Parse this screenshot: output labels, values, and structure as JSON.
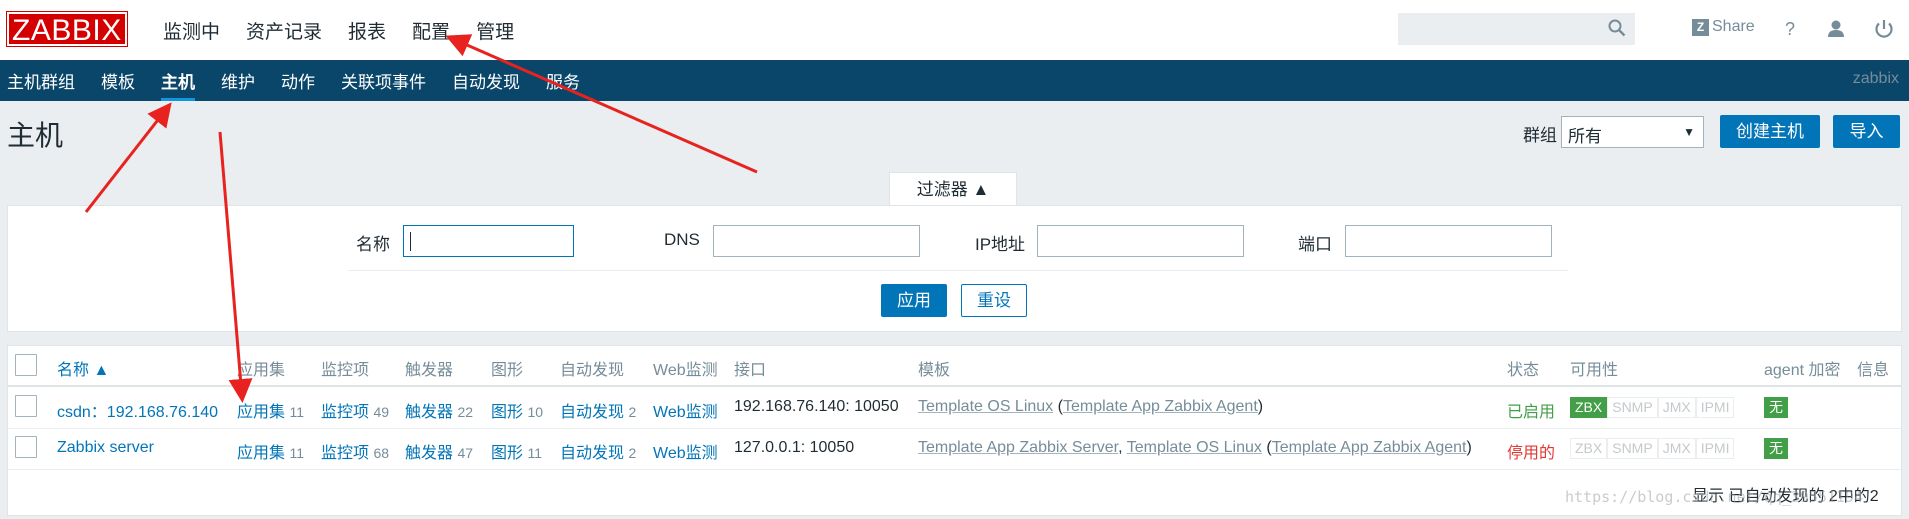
{
  "topbar": {
    "logo": "ZABBIX",
    "menu": [
      "监测中",
      "资产记录",
      "报表",
      "配置",
      "管理"
    ],
    "share_label": "Share",
    "share_badge": "Z",
    "help_glyph": "?"
  },
  "subbar": {
    "items": [
      "主机群组",
      "模板",
      "主机",
      "维护",
      "动作",
      "关联项事件",
      "自动发现",
      "服务"
    ],
    "active_index": 2,
    "user": "zabbix"
  },
  "header": {
    "title": "主机",
    "group_label": "群组",
    "group_value": "所有",
    "create_button": "创建主机",
    "import_button": "导入"
  },
  "filter": {
    "tab_label": "过滤器 ▲",
    "name_label": "名称",
    "dns_label": "DNS",
    "ip_label": "IP地址",
    "port_label": "端口",
    "name_value": "",
    "dns_value": "",
    "ip_value": "",
    "port_value": "",
    "apply_button": "应用",
    "reset_button": "重设"
  },
  "table": {
    "headers": {
      "name": "名称 ▲",
      "apps": "应用集",
      "items": "监控项",
      "triggers": "触发器",
      "graphs": "图形",
      "discovery": "自动发现",
      "web": "Web监测",
      "interface": "接口",
      "templates": "模板",
      "status": "状态",
      "availability": "可用性",
      "encryption": "agent 加密",
      "info": "信息"
    },
    "rows": [
      {
        "name": "csdn：192.168.76.140",
        "apps": "应用集",
        "apps_count": "11",
        "items": "监控项",
        "items_count": "49",
        "triggers": "触发器",
        "triggers_count": "22",
        "graphs": "图形",
        "graphs_count": "10",
        "discovery": "自动发现",
        "discovery_count": "2",
        "web": "Web监测",
        "interface": "192.168.76.140: 10050",
        "tmpl_1": "Template OS Linux",
        "tmpl_sep": " (",
        "tmpl_2": "Template App Zabbix Agent",
        "tmpl_end": ")",
        "status": "已启用",
        "encryption": "无"
      },
      {
        "name": "Zabbix server",
        "apps": "应用集",
        "apps_count": "11",
        "items": "监控项",
        "items_count": "68",
        "triggers": "触发器",
        "triggers_count": "47",
        "graphs": "图形",
        "graphs_count": "11",
        "discovery": "自动发现",
        "discovery_count": "2",
        "web": "Web监测",
        "interface": "127.0.0.1: 10050",
        "tmpl_1": "Template App Zabbix Server",
        "tmpl_sep1": ", ",
        "tmpl_2": "Template OS Linux",
        "tmpl_sep2": " (",
        "tmpl_3": "Template App Zabbix Agent",
        "tmpl_end": ")",
        "status": "停用的",
        "encryption": "无"
      }
    ],
    "availability_labels": [
      "ZBX",
      "SNMP",
      "JMX",
      "IPMI"
    ],
    "footer": "显示 已自动发现的 2中的2",
    "watermark": "https://blog.csdn.net/qq_39551194"
  },
  "colors": {
    "brand_red": "#d40000",
    "nav_blue": "#0a466a",
    "link_blue": "#0275b8",
    "ok_green": "#429e47",
    "err_red": "#e33734",
    "annotation_red": "#e8231f"
  }
}
